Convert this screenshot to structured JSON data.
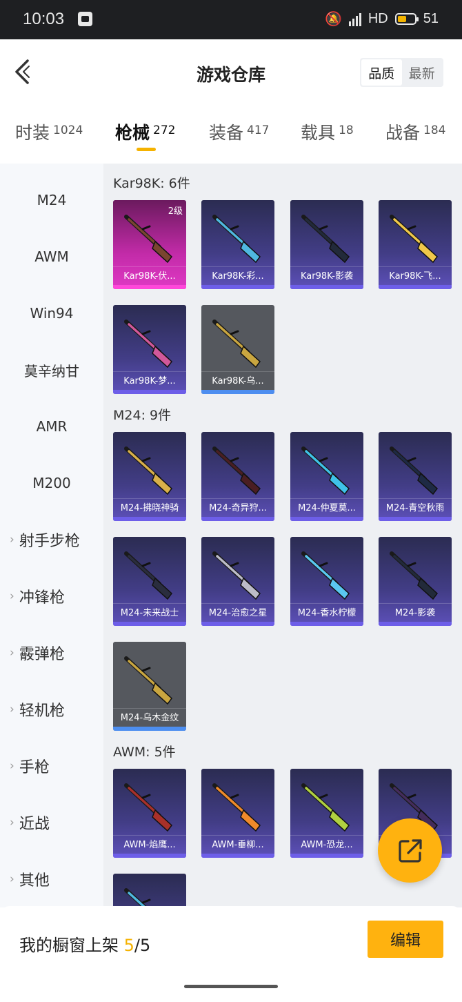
{
  "status_bar": {
    "time": "10:03",
    "network": "HD",
    "battery": "51",
    "battery_level": 0.51
  },
  "header": {
    "title": "游戏仓库",
    "sort_quality": "品质",
    "sort_newest": "最新"
  },
  "tabs": [
    {
      "label": "时装",
      "count": "1024"
    },
    {
      "label": "枪械",
      "count": "272",
      "active": true
    },
    {
      "label": "装备",
      "count": "417"
    },
    {
      "label": "载具",
      "count": "18"
    },
    {
      "label": "战备",
      "count": "184"
    }
  ],
  "sidebar": {
    "items": [
      "M24",
      "AWM",
      "Win94",
      "莫辛纳甘",
      "AMR",
      "M200"
    ],
    "groups": [
      "射手步枪",
      "冲锋枪",
      "霰弹枪",
      "轻机枪",
      "手枪",
      "近战",
      "其他"
    ]
  },
  "sections": [
    {
      "title": "Kar98K: 6件",
      "items": [
        {
          "label": "Kar98K-伏...",
          "level": "2级",
          "rarity": "pink"
        },
        {
          "label": "Kar98K-彩...",
          "rarity": "purple"
        },
        {
          "label": "Kar98K-影袭",
          "rarity": "purple"
        },
        {
          "label": "Kar98K-飞...",
          "rarity": "purple"
        },
        {
          "label": "Kar98K-梦...",
          "rarity": "purple"
        },
        {
          "label": "Kar98K-乌...",
          "rarity": "gray"
        }
      ]
    },
    {
      "title": "M24: 9件",
      "items": [
        {
          "label": "M24-拂晓神骑",
          "rarity": "purple"
        },
        {
          "label": "M24-奇异狩...",
          "rarity": "purple"
        },
        {
          "label": "M24-仲夏莫...",
          "rarity": "purple"
        },
        {
          "label": "M24-青空秋雨",
          "rarity": "purple"
        },
        {
          "label": "M24-未来战士",
          "rarity": "purple"
        },
        {
          "label": "M24-治愈之星",
          "rarity": "purple"
        },
        {
          "label": "M24-香水柠檬",
          "rarity": "purple"
        },
        {
          "label": "M24-影袭",
          "rarity": "purple"
        },
        {
          "label": "M24-乌木金纹",
          "rarity": "gray"
        }
      ]
    },
    {
      "title": "AWM: 5件",
      "items": [
        {
          "label": "AWM-焰鹰...",
          "rarity": "purple"
        },
        {
          "label": "AWM-垂柳...",
          "rarity": "purple"
        },
        {
          "label": "AWM-恐龙...",
          "rarity": "purple"
        },
        {
          "label": "",
          "rarity": "purple"
        },
        {
          "label": "",
          "rarity": "purple"
        }
      ]
    }
  ],
  "bottom": {
    "showcase_label": "我的橱窗上架",
    "showcase_current": "5",
    "showcase_total": "/5",
    "edit": "编辑"
  }
}
